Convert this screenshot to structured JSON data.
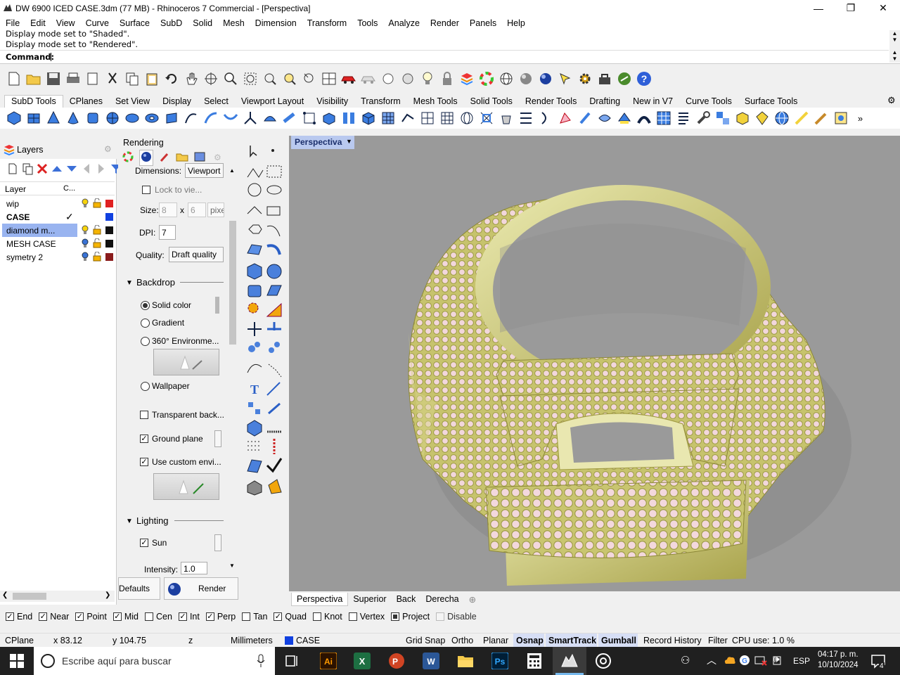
{
  "window": {
    "title": "DW 6900 ICED CASE.3dm (77 MB) - Rhinoceros 7 Commercial - [Perspectiva]",
    "minimize": "—",
    "maximize": "❐",
    "close": "✕"
  },
  "menu": [
    "File",
    "Edit",
    "View",
    "Curve",
    "Surface",
    "SubD",
    "Solid",
    "Mesh",
    "Dimension",
    "Transform",
    "Tools",
    "Analyze",
    "Render",
    "Panels",
    "Help"
  ],
  "command": {
    "history": [
      "Display mode set to \"Shaded\".",
      "Display mode set to \"Rendered\"."
    ],
    "prompt": "Command:"
  },
  "toolbar_tabs": [
    "SubD Tools",
    "CPlanes",
    "Set View",
    "Display",
    "Select",
    "Viewport Layout",
    "Visibility",
    "Transform",
    "Mesh Tools",
    "Solid Tools",
    "Render Tools",
    "Drafting",
    "New in V7",
    "Curve Tools",
    "Surface Tools"
  ],
  "layers": {
    "panel_title": "Layers",
    "col_layer": "Layer",
    "col_current": "C...",
    "rows": [
      {
        "name": "wip",
        "current": "",
        "color": "#e02020"
      },
      {
        "name": "CASE",
        "current": "✓",
        "color": "#1040e0"
      },
      {
        "name": "diamond m...",
        "current": "",
        "color": "#101010"
      },
      {
        "name": "MESH CASE",
        "current": "",
        "color": "#101010"
      },
      {
        "name": "symetry 2",
        "current": "",
        "color": "#8a1c1c"
      }
    ]
  },
  "rendering": {
    "panel_title": "Rendering",
    "dimensions_label": "Dimensions:",
    "dimensions_value": "Viewport",
    "lock_label": "Lock to vie...",
    "size_label": "Size:",
    "size_w": "8",
    "size_x": "x",
    "size_h": "6",
    "size_unit": "pixe",
    "dpi_label": "DPI:",
    "dpi_value": "7",
    "quality_label": "Quality:",
    "quality_value": "Draft quality",
    "backdrop_title": "Backdrop",
    "solid_color": "Solid color",
    "gradient": "Gradient",
    "env360": "360° Environme...",
    "wallpaper": "Wallpaper",
    "transparent": "Transparent back...",
    "ground_plane": "Ground plane",
    "custom_env": "Use custom envi...",
    "lighting_title": "Lighting",
    "sun": "Sun",
    "intensity_label": "Intensity:",
    "intensity_value": "1.0",
    "defaults_btn": "Defaults",
    "render_btn": "Render"
  },
  "viewport": {
    "label": "Perspectiva",
    "tabs": [
      "Perspectiva",
      "Superior",
      "Back",
      "Derecha"
    ],
    "add_tab": "⊕"
  },
  "osnaps": [
    {
      "label": "End",
      "checked": true
    },
    {
      "label": "Near",
      "checked": true
    },
    {
      "label": "Point",
      "checked": true
    },
    {
      "label": "Mid",
      "checked": true
    },
    {
      "label": "Cen",
      "checked": false
    },
    {
      "label": "Int",
      "checked": true
    },
    {
      "label": "Perp",
      "checked": true
    },
    {
      "label": "Tan",
      "checked": false
    },
    {
      "label": "Quad",
      "checked": true
    },
    {
      "label": "Knot",
      "checked": false
    },
    {
      "label": "Vertex",
      "checked": false
    },
    {
      "label": "Project",
      "checked": "square"
    },
    {
      "label": "Disable",
      "checked": "disabled"
    }
  ],
  "status": {
    "cplane": "CPlane",
    "x": "x 83.12",
    "y": "y 104.75",
    "z": "z",
    "units": "Millimeters",
    "layer": "CASE",
    "layer_color": "#1040e0",
    "grid_snap": "Grid Snap",
    "ortho": "Ortho",
    "planar": "Planar",
    "osnap": "Osnap",
    "smarttrack": "SmartTrack",
    "gumball": "Gumball",
    "record_history": "Record History",
    "filter": "Filter",
    "cpu": "CPU use: 1.0 %"
  },
  "taskbar": {
    "search_placeholder": "Escribe aquí para buscar",
    "lang": "ESP",
    "time": "04:17 p. m.",
    "date": "10/10/2024",
    "notifications": "4"
  }
}
